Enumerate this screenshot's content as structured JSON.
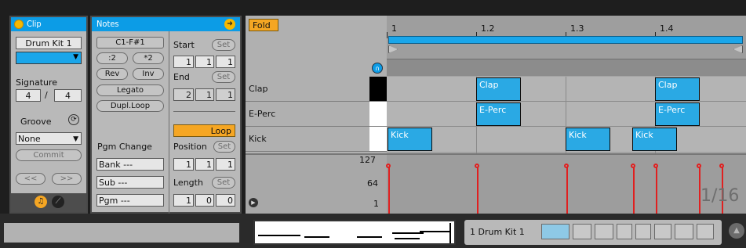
{
  "clip": {
    "header": "Clip",
    "name": "Drum Kit 1",
    "signature_label": "Signature",
    "sig_num": "4",
    "sig_sep": "/",
    "sig_den": "4",
    "groove_label": "Groove",
    "groove_value": "None",
    "commit": "Commit",
    "nav_back": "<<",
    "nav_fwd": ">>",
    "color": "#1aa6ea"
  },
  "notes": {
    "header": "Notes",
    "range": "C1-F#1",
    "half": ":2",
    "double": "*2",
    "rev": "Rev",
    "inv": "Inv",
    "legato": "Legato",
    "dupl": "Dupl.Loop",
    "start_label": "Start",
    "start_set": "Set",
    "start_vals": [
      "1",
      "1",
      "1"
    ],
    "end_label": "End",
    "end_set": "Set",
    "end_vals": [
      "2",
      "1",
      "1"
    ],
    "loop": "Loop",
    "position_label": "Position",
    "position_set": "Set",
    "position_vals": [
      "1",
      "1",
      "1"
    ],
    "length_label": "Length",
    "length_set": "Set",
    "length_vals": [
      "1",
      "0",
      "0"
    ],
    "pgm_label": "Pgm Change",
    "bank": "Bank ---",
    "sub": "Sub ---",
    "pgm": "Pgm ---"
  },
  "editor": {
    "fold": "Fold",
    "ruler": [
      "1",
      "1.2",
      "1.3",
      "1.4"
    ],
    "lanes": [
      "Clap",
      "E-Perc",
      "Kick"
    ],
    "notes": {
      "clap1": "Clap",
      "clap2": "Clap",
      "eperc1": "E-Perc",
      "eperc2": "E-Perc",
      "kick1": "Kick",
      "kick2": "Kick",
      "kick3": "Kick"
    },
    "vel_max": "127",
    "vel_mid": "64",
    "vel_min": "1",
    "grid": "1/16"
  },
  "bottom": {
    "track_name": "1 Drum Kit 1"
  },
  "colors": {
    "accent": "#0c9ce6",
    "loop": "#f5a623",
    "velocity": "#e02020"
  }
}
